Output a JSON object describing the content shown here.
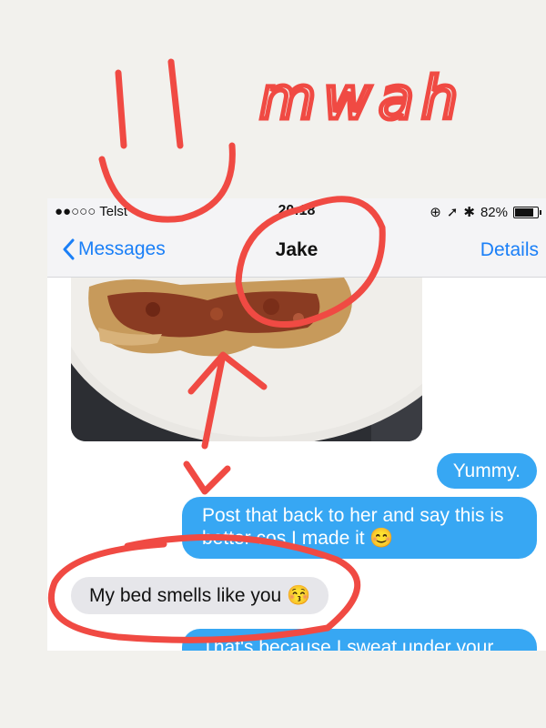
{
  "status_bar": {
    "carrier": "●●○○○ Telst",
    "time": "20:18",
    "battery": "82%",
    "battery_level": 0.82
  },
  "nav": {
    "back_label": "Messages",
    "title": "Jake",
    "details_label": "Details"
  },
  "messages": [
    {
      "direction": "outgoing",
      "text": "Yummy."
    },
    {
      "direction": "outgoing",
      "text": "Post that back to her and say this is better cos I made it 😊"
    },
    {
      "direction": "incoming",
      "text": "My bed smells like you 😚"
    },
    {
      "direction": "outgoing",
      "text": "That's because I sweat under your"
    }
  ],
  "annotation": {
    "text": "mwah",
    "color": "#f04a43"
  },
  "colors": {
    "ios_blue": "#1a7ff7",
    "outgoing_bubble": "#37a7f3",
    "incoming_bubble": "#e6e6ea",
    "background": "#f2f1ed"
  }
}
